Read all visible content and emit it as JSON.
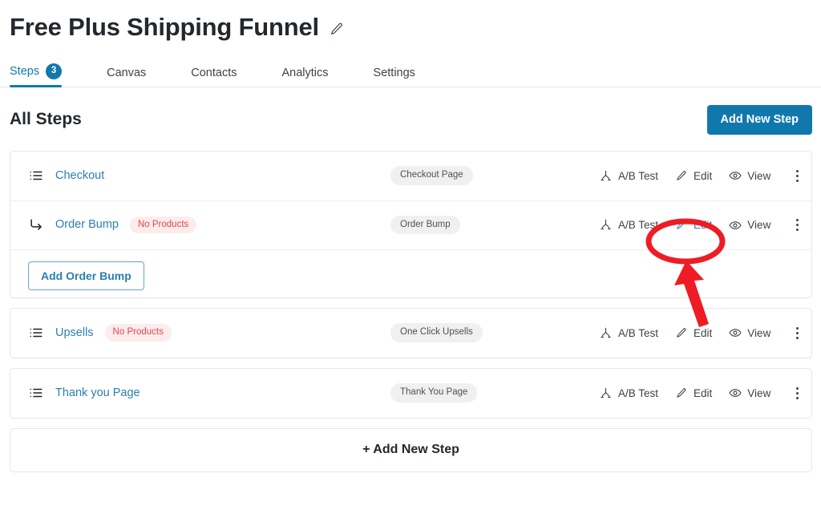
{
  "header": {
    "title": "Free Plus Shipping Funnel",
    "edit_icon": "pencil-icon"
  },
  "tabs": [
    {
      "label": "Steps",
      "badge": "3",
      "active": true
    },
    {
      "label": "Canvas",
      "badge": "",
      "active": false
    },
    {
      "label": "Contacts",
      "badge": "",
      "active": false
    },
    {
      "label": "Analytics",
      "badge": "",
      "active": false
    },
    {
      "label": "Settings",
      "badge": "",
      "active": false
    }
  ],
  "section": {
    "title": "All Steps",
    "add_new_step_button": "Add New Step"
  },
  "actions": {
    "ab_test": "A/B Test",
    "edit": "Edit",
    "view": "View",
    "more": "kebab-menu-icon"
  },
  "steps": [
    {
      "name": "Checkout",
      "icon": "list-icon",
      "badge": "",
      "type": "Checkout Page",
      "edit_highlighted": false
    },
    {
      "name": "Order Bump",
      "icon": "arrow-turn-right-icon",
      "badge": "No Products",
      "type": "Order Bump",
      "edit_highlighted": true
    },
    {
      "name": "Upsells",
      "icon": "list-icon",
      "badge": "No Products",
      "type": "One Click Upsells",
      "edit_highlighted": false
    },
    {
      "name": "Thank you Page",
      "icon": "list-icon",
      "badge": "",
      "type": "Thank You Page",
      "edit_highlighted": false
    }
  ],
  "order_bump": {
    "add_button": "Add Order Bump"
  },
  "footer": {
    "add_new_step": "+ Add New Step"
  },
  "annotation": {
    "shape": "red-ellipse-with-arrow",
    "target": "Edit",
    "color": "#ee1c25"
  },
  "colors": {
    "primary_blue": "#1178ad",
    "link_blue": "#2b7fb0",
    "danger_red": "#e2464a",
    "annotation_red": "#ee1c25",
    "pill_gray": "#f0f0f1"
  }
}
